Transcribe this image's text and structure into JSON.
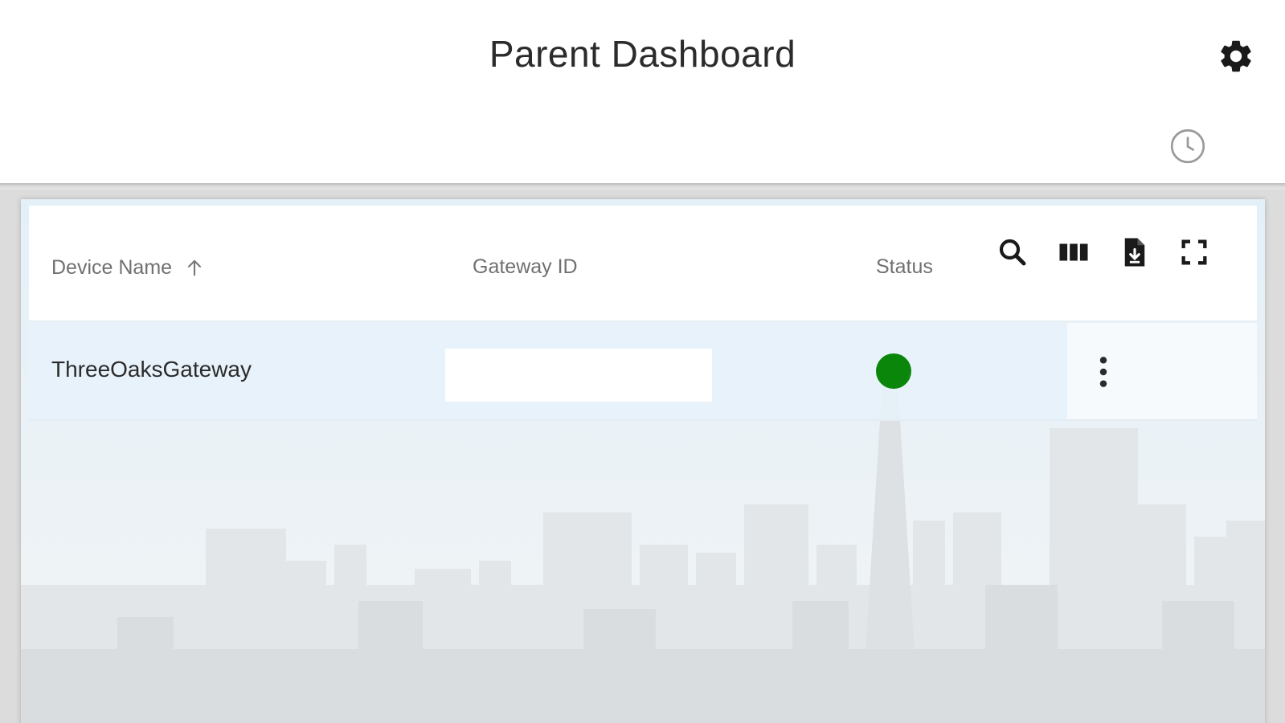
{
  "header": {
    "title": "Parent Dashboard",
    "settings_icon": "gear-icon",
    "history_icon": "clock-icon"
  },
  "table": {
    "columns": {
      "device_name": "Device Name",
      "gateway_id": "Gateway ID",
      "status": "Status"
    },
    "sort": {
      "column": "Device Name",
      "direction": "ascending",
      "icon": "arrow-up-icon"
    },
    "toolbar_icons": [
      "search-icon",
      "view-column-icon",
      "file-download-icon",
      "fullscreen-icon"
    ],
    "rows": [
      {
        "device_name": "ThreeOaksGateway",
        "gateway_id": "",
        "status_color": "#0a870a",
        "menu_icon": "more-vert-icon"
      }
    ]
  },
  "colors": {
    "status_online": "#0a870a",
    "accent_dark": "#1f1f1f"
  }
}
